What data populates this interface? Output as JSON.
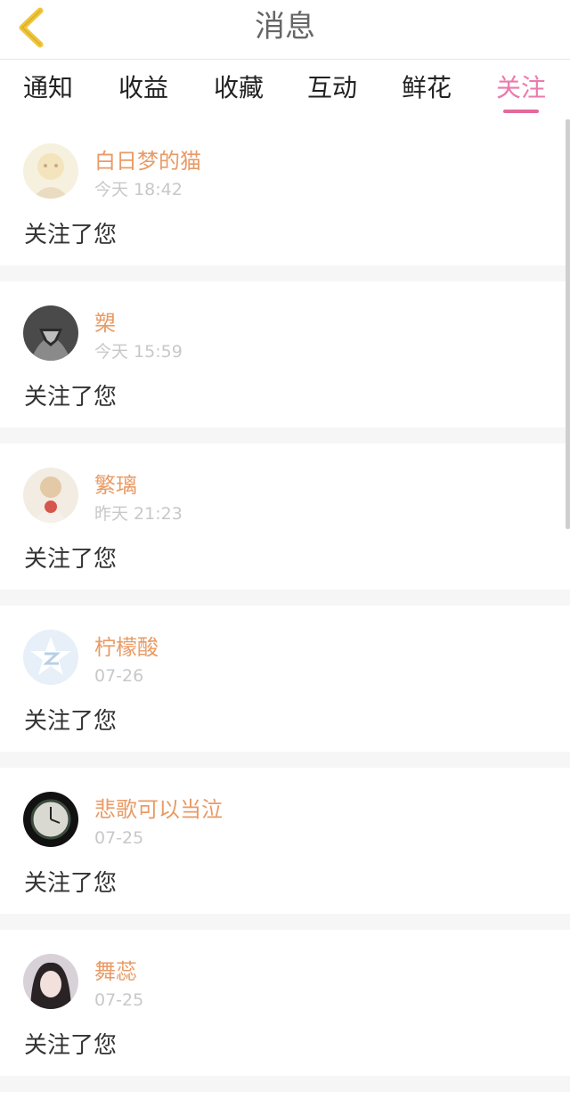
{
  "header": {
    "title": "消息",
    "back_icon": "chevron-left-icon",
    "back_color": "#f1c63a"
  },
  "tabs": [
    {
      "label": "通知",
      "active": false
    },
    {
      "label": "收益",
      "active": false
    },
    {
      "label": "收藏",
      "active": false
    },
    {
      "label": "互动",
      "active": false
    },
    {
      "label": "鲜花",
      "active": false
    },
    {
      "label": "关注",
      "active": true
    }
  ],
  "colors": {
    "accent": "#e36a9d",
    "name": "#e99b66",
    "time": "#c8c8c8"
  },
  "items": [
    {
      "name": "白日梦的猫",
      "time": "今天 18:42",
      "message": "关注了您"
    },
    {
      "name": "槊",
      "time": "今天 15:59",
      "message": "关注了您"
    },
    {
      "name": "繁璃",
      "time": "昨天 21:23",
      "message": "关注了您"
    },
    {
      "name": "柠檬酸",
      "time": "07-26",
      "message": "关注了您"
    },
    {
      "name": "悲歌可以当泣",
      "time": "07-25",
      "message": "关注了您"
    },
    {
      "name": "舞蕊",
      "time": "07-25",
      "message": "关注了您"
    }
  ]
}
